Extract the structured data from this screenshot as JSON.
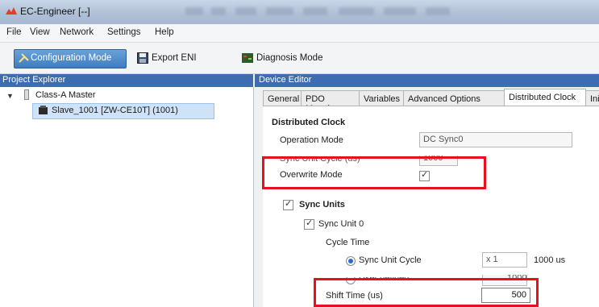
{
  "window": {
    "title": "EC-Engineer [--]"
  },
  "menu": {
    "items": [
      "File",
      "View",
      "Network",
      "Settings",
      "Help"
    ]
  },
  "toolbar": {
    "configuration_mode": "Configuration Mode",
    "export_eni": "Export ENI",
    "diagnosis_mode": "Diagnosis Mode"
  },
  "project_explorer": {
    "header": "Project Explorer",
    "master": "Class-A Master",
    "slave": "Slave_1001 [ZW-CE10T] (1001)"
  },
  "device_editor": {
    "header": "Device Editor",
    "tabs": [
      "General",
      "PDO Mapping",
      "Variables",
      "Advanced Options",
      "Distributed Clock",
      "Ini"
    ],
    "active_tab": "Distributed Clock",
    "section_title": "Distributed Clock",
    "operation_mode_label": "Operation Mode",
    "operation_mode_value": "DC Sync0",
    "sync_unit_cycle_label": "Sync Unit Cycle (us)",
    "sync_unit_cycle_value": "1000",
    "overwrite_mode_label": "Overwrite Mode",
    "sync_units_label": "Sync Units",
    "sync_unit_0_label": "Sync Unit 0",
    "cycle_time_label": "Cycle Time",
    "radio_sync_unit_cycle": "Sync Unit Cycle",
    "multiplier_value": "x 1",
    "cycle_result": "1000 us",
    "radio_user_defined": "User defined",
    "user_defined_value": "1000",
    "shift_time_label": "Shift Time (us)",
    "shift_time_value": "500"
  },
  "colors": {
    "panel_header": "#3d6db0",
    "highlight_box": "#e8111b",
    "selection": "#cfe3f8"
  }
}
